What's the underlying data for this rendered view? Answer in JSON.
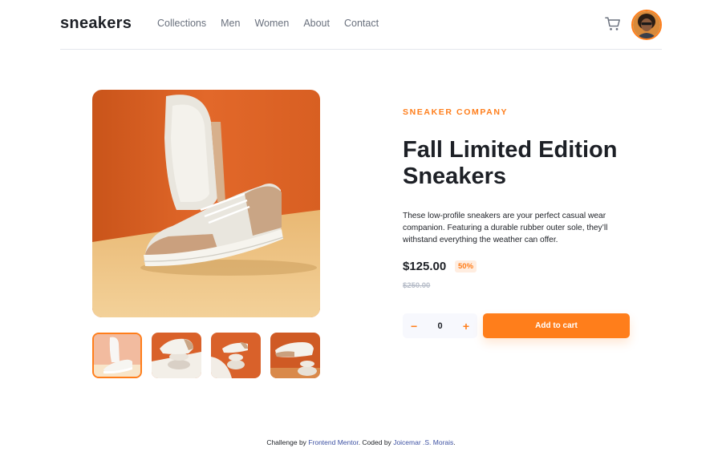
{
  "header": {
    "logo": "sneakers",
    "nav": [
      "Collections",
      "Men",
      "Women",
      "About",
      "Contact"
    ],
    "cart_icon": "cart-icon",
    "avatar_icon": "avatar"
  },
  "gallery": {
    "main_image": "sneaker-photo-main",
    "thumbnails": [
      "sneaker-thumbnail-1",
      "sneaker-thumbnail-2",
      "sneaker-thumbnail-3",
      "sneaker-thumbnail-4"
    ],
    "active_thumbnail": 1
  },
  "product": {
    "company": "SNEAKER COMPANY",
    "title": "Fall Limited Edition Sneakers",
    "description": "These low-profile sneakers are your perfect casual wear companion. Featuring a durable rubber outer sole, they’ll withstand everything the weather can offer.",
    "price": "$125.00",
    "discount": "50%",
    "old_price": "$250.00"
  },
  "cart_controls": {
    "minus": "−",
    "quantity": "0",
    "plus": "+",
    "add_label": "Add to cart"
  },
  "footer": {
    "prefix": "Challenge by",
    "challenge_link": "Frontend Mentor",
    "middle": ". Coded by",
    "author_link": "Joicemar .S. Morais",
    "suffix": "."
  },
  "colors": {
    "accent": "#ff7e1b",
    "accent_pale": "#ffede0",
    "text_dark": "#1d2026",
    "text_gray": "#69707d",
    "link_blue": "#3e52a3"
  }
}
